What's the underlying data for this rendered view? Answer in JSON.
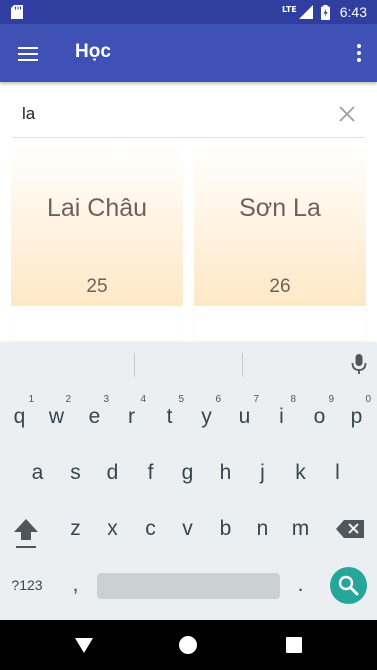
{
  "status_bar": {
    "time": "6:43",
    "network": "LTE",
    "icons": [
      "sd-card-icon",
      "signal-icon",
      "battery-charging-icon"
    ]
  },
  "app_bar": {
    "title": "Học",
    "icons": [
      "menu-icon",
      "more-vert-icon"
    ]
  },
  "search": {
    "value": "la",
    "clear_icon": "close-icon"
  },
  "results": [
    {
      "name": "Lai Châu",
      "number": "25"
    },
    {
      "name": "Sơn La",
      "number": "26"
    }
  ],
  "keyboard": {
    "row1": [
      "q",
      "w",
      "e",
      "r",
      "t",
      "y",
      "u",
      "i",
      "o",
      "p"
    ],
    "row1_hints": [
      "1",
      "2",
      "3",
      "4",
      "5",
      "6",
      "7",
      "8",
      "9",
      "0"
    ],
    "row2": [
      "a",
      "s",
      "d",
      "f",
      "g",
      "h",
      "j",
      "k",
      "l"
    ],
    "row3": [
      "z",
      "x",
      "c",
      "v",
      "b",
      "n",
      "m"
    ],
    "symbols_label": "?123",
    "comma": ",",
    "period": ".",
    "accent_color": "#26a69a"
  },
  "colors": {
    "primary": "#3f51b5",
    "primary_dark": "#303f9f",
    "card_gradient_end": "#ffe8c6"
  }
}
